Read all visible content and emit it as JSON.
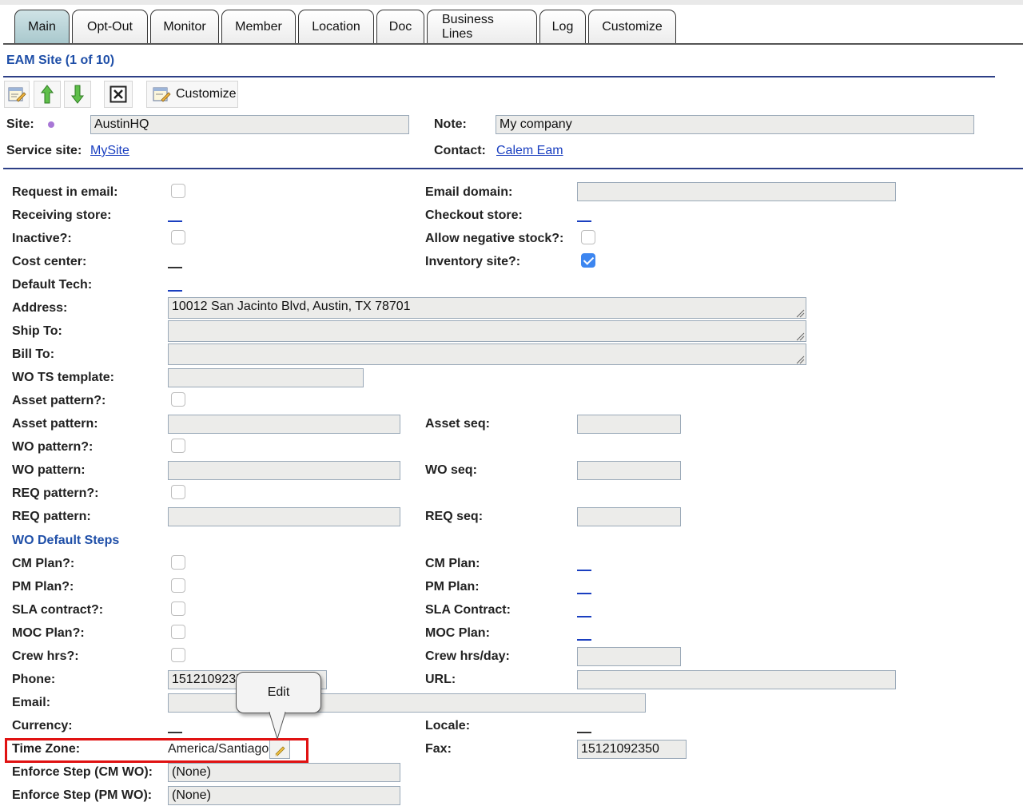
{
  "tabs": [
    {
      "label": "Main",
      "active": true
    },
    {
      "label": "Opt-Out"
    },
    {
      "label": "Monitor"
    },
    {
      "label": "Member"
    },
    {
      "label": "Location"
    },
    {
      "label": "Doc"
    },
    {
      "label": "Business Lines"
    },
    {
      "label": "Log"
    },
    {
      "label": "Customize"
    }
  ],
  "header": {
    "title": "EAM Site (1 of 10)"
  },
  "toolbar": {
    "customize_label": "Customize",
    "icons": [
      "edit-form-icon",
      "arrow-up-icon",
      "arrow-down-icon",
      "close-box-icon",
      "customize-icon"
    ]
  },
  "top": {
    "site_label": "Site:",
    "site_value": "AustinHQ",
    "note_label": "Note:",
    "note_value": "My company",
    "service_site_label": "Service site:",
    "service_site_value": "MySite",
    "contact_label": "Contact:",
    "contact_value": "Calem Eam"
  },
  "form": {
    "request_in_email": "Request in email:",
    "email_domain": "Email domain:",
    "receiving_store": "Receiving store:",
    "checkout_store": "Checkout store:",
    "inactive": "Inactive?:",
    "allow_negative_stock": "Allow negative stock?:",
    "cost_center": "Cost center:",
    "inventory_site": "Inventory site?:",
    "default_tech": "Default Tech:",
    "address": "Address:",
    "address_value": "10012 San Jacinto Blvd, Austin, TX 78701",
    "ship_to": "Ship To:",
    "bill_to": "Bill To:",
    "wo_ts_template": "WO TS template:",
    "asset_pattern_q": "Asset pattern?:",
    "asset_pattern": "Asset pattern:",
    "asset_seq": "Asset seq:",
    "wo_pattern_q": "WO pattern?:",
    "wo_pattern": "WO pattern:",
    "wo_seq": "WO seq:",
    "req_pattern_q": "REQ pattern?:",
    "req_pattern": "REQ pattern:",
    "req_seq": "REQ seq:",
    "wo_default_steps": "WO Default Steps",
    "cm_plan_q": "CM Plan?:",
    "cm_plan": "CM Plan:",
    "pm_plan_q": "PM Plan?:",
    "pm_plan": "PM Plan:",
    "sla_contract_q": "SLA contract?:",
    "sla_contract": "SLA Contract:",
    "moc_plan_q": "MOC Plan?:",
    "moc_plan": "MOC Plan:",
    "crew_hrs_q": "Crew hrs?:",
    "crew_hrs_day": "Crew hrs/day:",
    "phone": "Phone:",
    "phone_value": "1512109235",
    "url": "URL:",
    "email": "Email:",
    "currency": "Currency:",
    "locale": "Locale:",
    "time_zone": "Time Zone:",
    "time_zone_value": "America/Santiago",
    "fax": "Fax:",
    "fax_value": "15121092350",
    "enforce_cm": "Enforce Step (CM WO):",
    "enforce_cm_value": "(None)",
    "enforce_pm": "Enforce Step (PM WO):",
    "enforce_pm_value": "(None)"
  },
  "tooltip": {
    "text": "Edit"
  },
  "colors": {
    "accent_blue": "#1f4fa8",
    "link": "#1a3fc0",
    "highlight": "#e01212",
    "tab_active": "#b7d2d6",
    "field_bg": "#ececea",
    "checked": "#3d86f0"
  }
}
